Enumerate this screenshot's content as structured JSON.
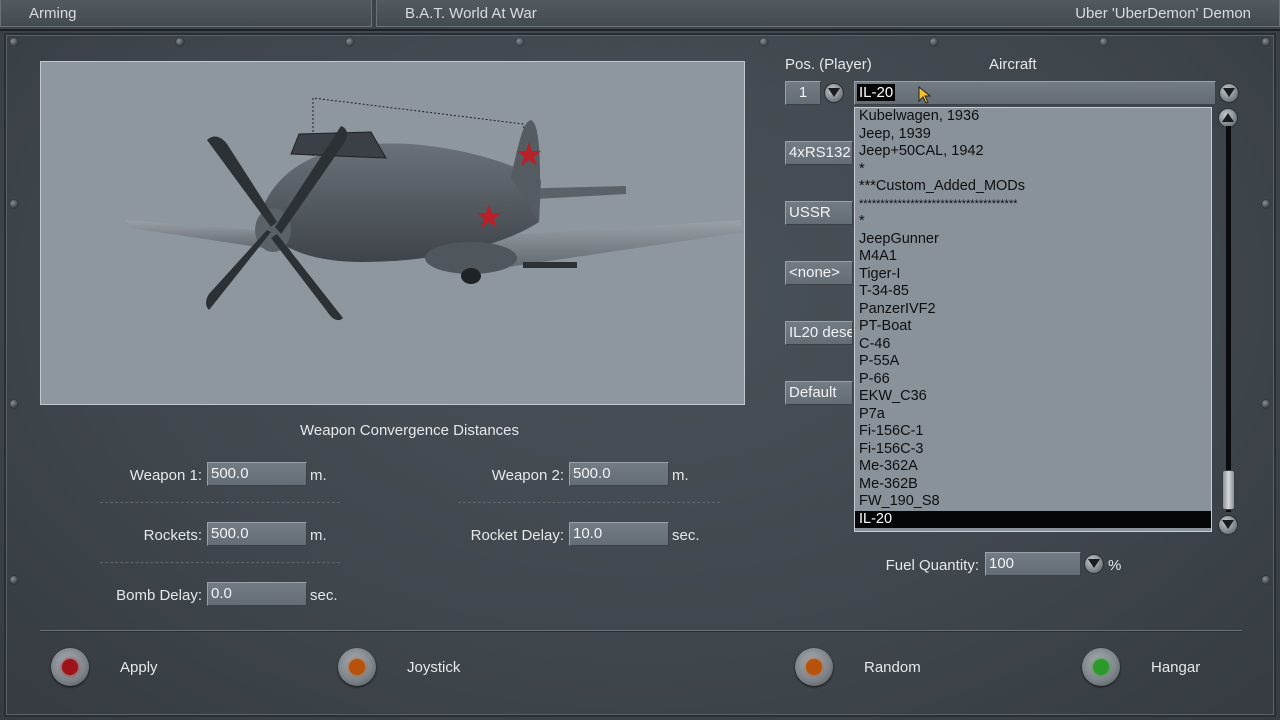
{
  "titlebar": {
    "screen": "Arming",
    "game_title": "B.A.T. World At War",
    "player": "Uber 'UberDemon' Demon"
  },
  "header": {
    "pos_label": "Pos. (Player)",
    "aircraft_label": "Aircraft"
  },
  "pos_value": "1",
  "aircraft_value": "IL-20",
  "side_fields": [
    "4xRS132",
    "USSR",
    "<none>",
    "IL20 dese",
    "Default"
  ],
  "aircraft_list": [
    "Kubelwagen, 1936",
    "Jeep, 1939",
    "Jeep+50CAL, 1942",
    "*",
    "***Custom_Added_MODs",
    "*************************************",
    "*",
    "JeepGunner",
    "M4A1",
    "Tiger-I",
    "T-34-85",
    "PanzerIVF2",
    "PT-Boat",
    "C-46",
    "P-55A",
    "P-66",
    "EKW_C36",
    "P7a",
    "Fi-156C-1",
    "Fi-156C-3",
    "Me-362A",
    "Me-362B",
    "FW_190_S8",
    "IL-20"
  ],
  "convergence": {
    "title": "Weapon Convergence Distances",
    "weapon1_label": "Weapon 1:",
    "weapon1_value": "500.0",
    "weapon2_label": "Weapon 2:",
    "weapon2_value": "500.0",
    "rockets_label": "Rockets:",
    "rockets_value": "500.0",
    "rocket_delay_label": "Rocket Delay:",
    "rocket_delay_value": "10.0",
    "bomb_delay_label": "Bomb Delay:",
    "bomb_delay_value": "0.0",
    "unit_m": "m.",
    "unit_sec": "sec."
  },
  "fuel": {
    "label": "Fuel Quantity:",
    "value": "100",
    "unit": "%"
  },
  "buttons": {
    "apply": "Apply",
    "joystick": "Joystick",
    "random": "Random",
    "hangar": "Hangar"
  },
  "colors": {
    "apply_led": "#a0121a",
    "joystick_led": "#b8520a",
    "random_led": "#b8520a",
    "hangar_led": "#2c9a2a"
  }
}
